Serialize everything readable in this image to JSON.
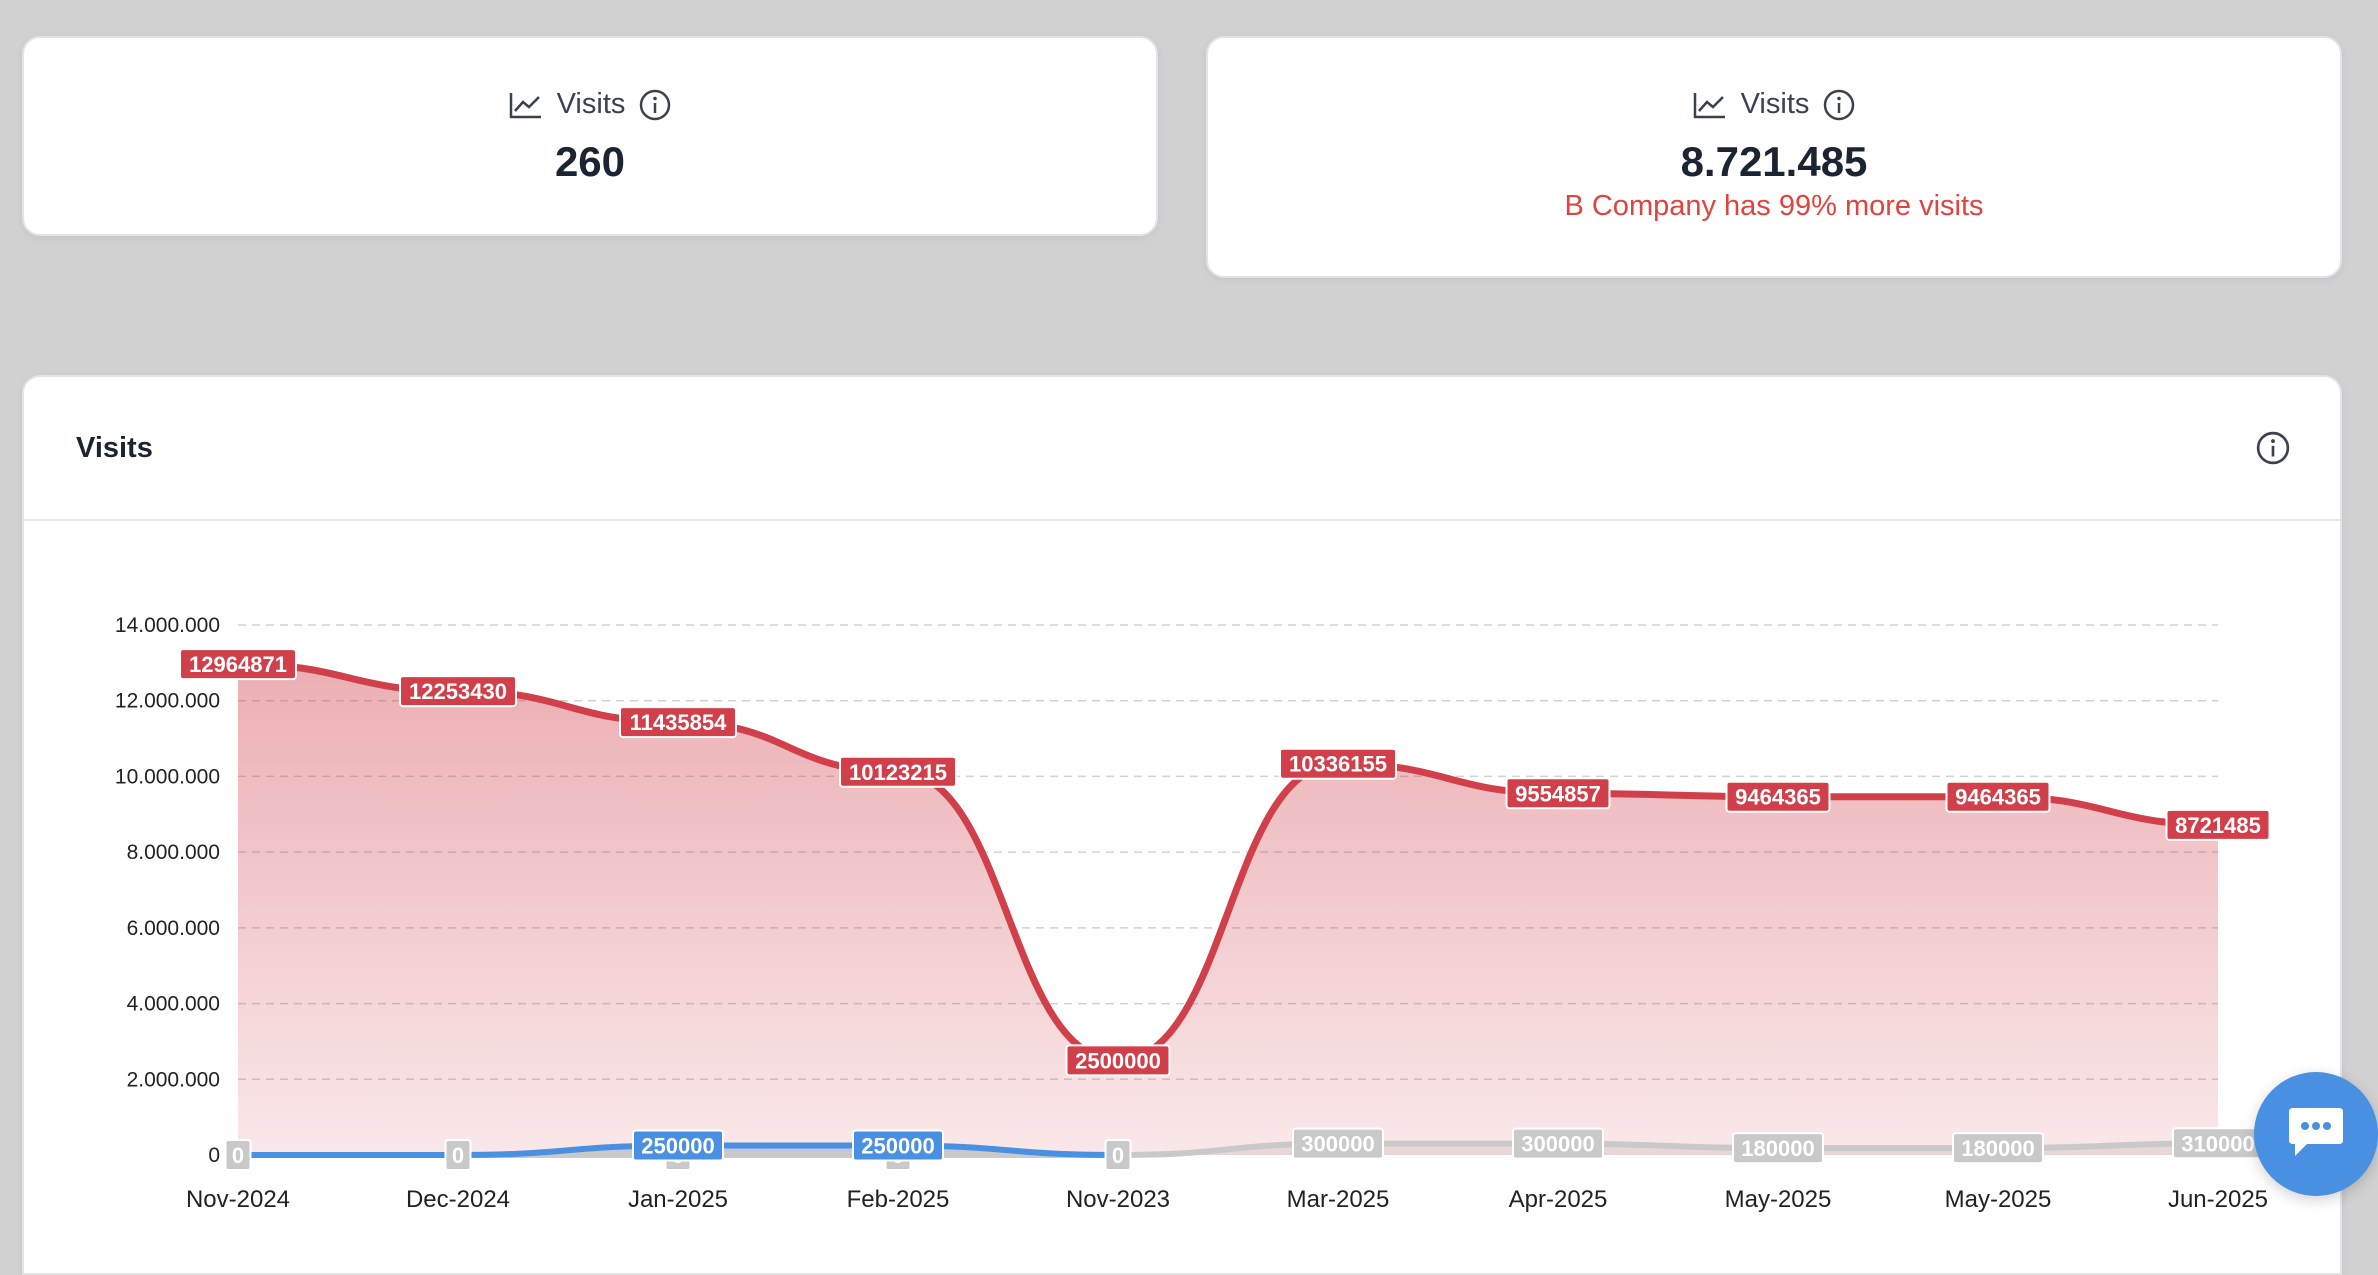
{
  "stat_a": {
    "label": "Visits",
    "value": "260",
    "icon": "trend-chart-icon"
  },
  "stat_b": {
    "label": "Visits",
    "value": "8.721.485",
    "note": "B Company has 99% more visits",
    "icon": "trend-chart-icon"
  },
  "chart_card": {
    "title": "Visits"
  },
  "colors": {
    "red": "#d1404a",
    "blue": "#4a90e2",
    "gray": "#c9c9c9",
    "note": "#e0443e"
  },
  "chart_data": {
    "type": "area",
    "categories": [
      "Nov-2024",
      "Dec-2024",
      "Jan-2025",
      "Feb-2025",
      "Nov-2023",
      "Mar-2025",
      "Apr-2025",
      "May-2025",
      "May-2025",
      "Jun-2025"
    ],
    "yticks": [
      "14.000.000",
      "12.000.000",
      "10.000.000",
      "8.000.000",
      "6.000.000",
      "4.000.000",
      "2.000.000",
      "0"
    ],
    "ylim": [
      0,
      14000000
    ],
    "grid": true,
    "series": [
      {
        "color": "#d1404a",
        "values": [
          12964871,
          12253430,
          11435854,
          10123215,
          2500000,
          10336155,
          9554857,
          9464365,
          9464365,
          8721485
        ],
        "labels": [
          "12964871",
          "12253430",
          "11435854",
          "10123215",
          "2500000",
          "10336155",
          "9554857",
          "9464365",
          "9464365",
          "8721485"
        ]
      },
      {
        "color": "#4a90e2",
        "values": [
          0,
          0,
          250000,
          250000,
          0,
          null,
          null,
          null,
          null,
          null
        ],
        "labels": [
          null,
          null,
          "250000",
          "250000",
          null,
          null,
          null,
          null,
          null,
          null
        ]
      },
      {
        "color": "#c9c9c9",
        "values": [
          0,
          0,
          0,
          0,
          0,
          300000,
          300000,
          180000,
          180000,
          310000
        ],
        "labels": [
          "0",
          "0",
          "0",
          "0",
          "0",
          "300000",
          "300000",
          "180000",
          "180000",
          "310000"
        ]
      }
    ]
  },
  "chat": {
    "icon": "chat-bubble-icon"
  }
}
